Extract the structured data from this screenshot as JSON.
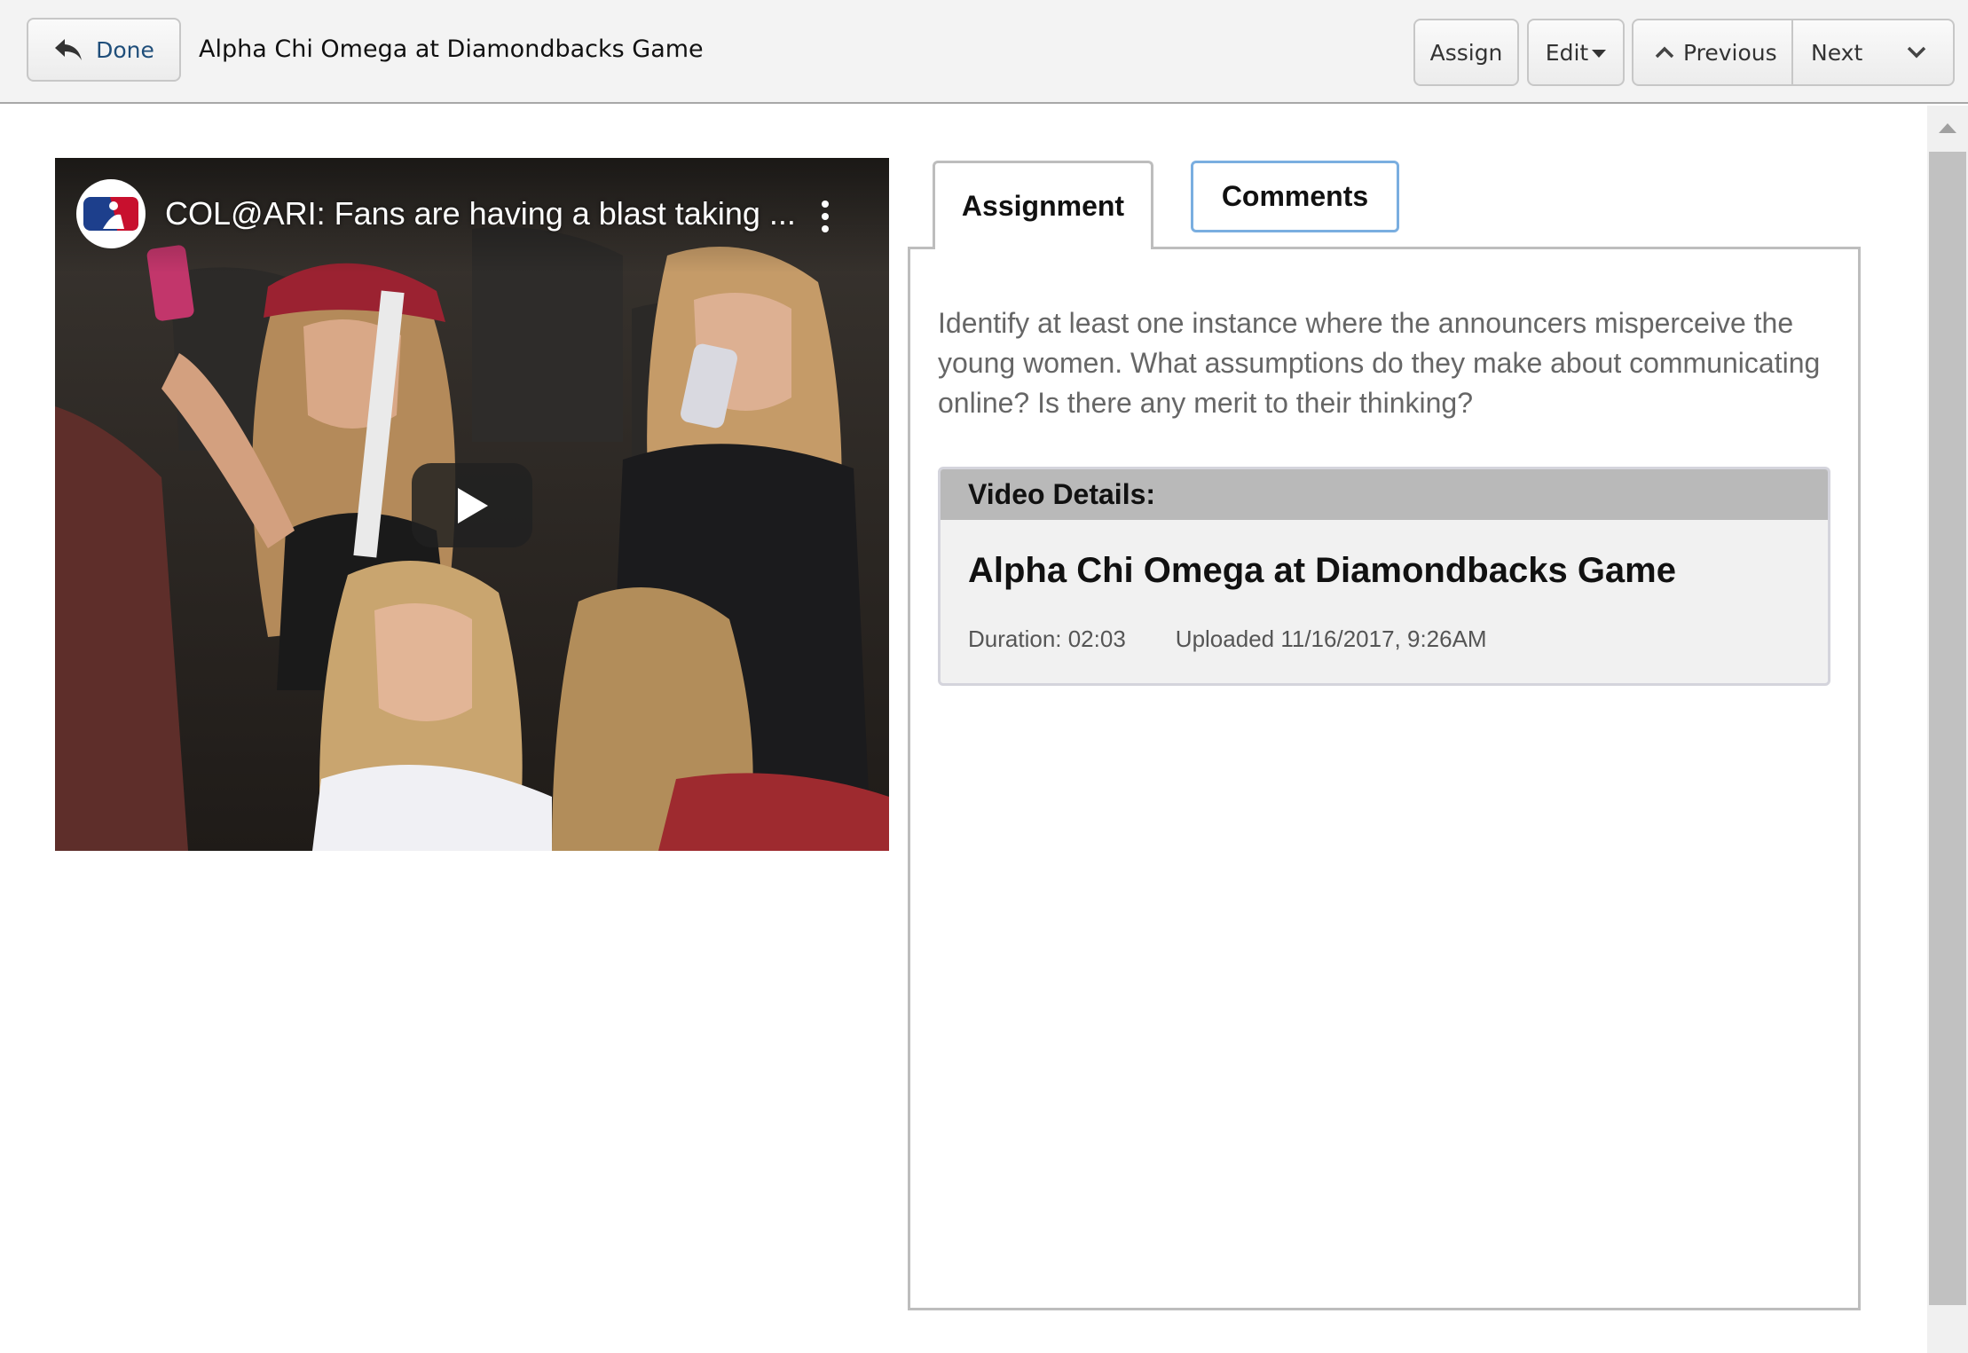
{
  "toolbar": {
    "done_label": "Done",
    "title": "Alpha Chi Omega at Diamondbacks Game",
    "assign_label": "Assign",
    "edit_label": "Edit",
    "previous_label": "Previous",
    "next_label": "Next"
  },
  "video": {
    "title": "COL@ARI: Fans are having a blast taking ...",
    "channel_logo": "mlb-logo",
    "play_icon": "play-icon",
    "menu_icon": "more-vertical-icon"
  },
  "tabs": [
    {
      "label": "Assignment",
      "active": true
    },
    {
      "label": "Comments",
      "active": false
    }
  ],
  "assignment": {
    "prompt": "Identify at least one instance where the announcers misperceive the young women. What assumptions do they make about communicating online? Is there any merit to their thinking?",
    "details_header": "Video Details:",
    "video_title": "Alpha Chi Omega at Diamondbacks Game",
    "duration": "Duration: 02:03",
    "uploaded": "Uploaded 11/16/2017, 9:26AM"
  },
  "colors": {
    "toolbar_bg": "#f3f3f3",
    "done_text": "#1f4e7a",
    "tab_active_border": "#bdbdbd",
    "tab_inactive_border": "#7aaee0",
    "details_header_bg": "#b9b9b9",
    "prompt_text": "#666666"
  }
}
